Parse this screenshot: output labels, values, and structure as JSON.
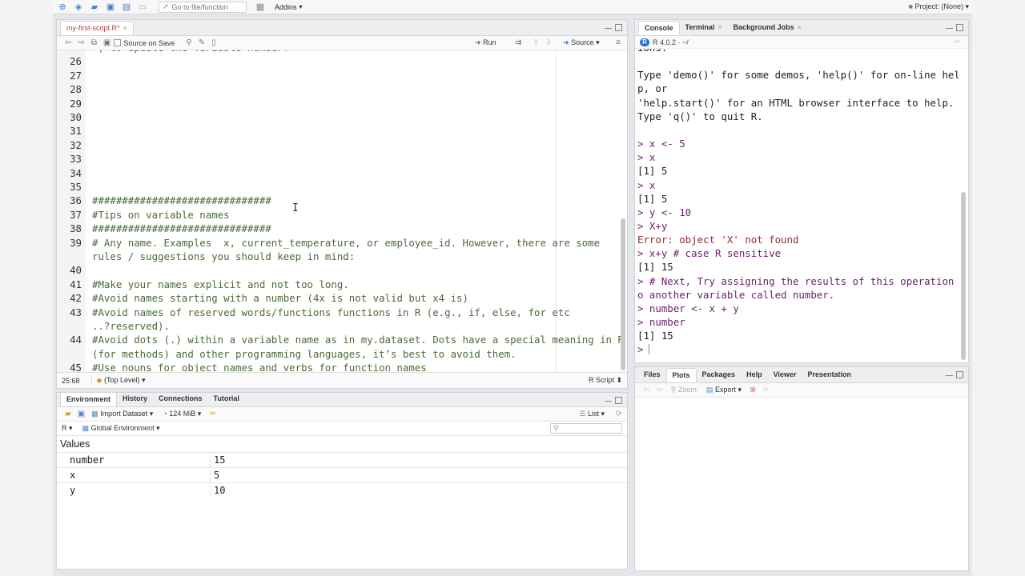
{
  "topbar": {
    "goto_placeholder": "Go to file/function",
    "addins_label": "Addins",
    "project_label": "Project: (None)"
  },
  "editor": {
    "tab_label": "my-first-script.R*",
    "source_on_save": "Source on Save",
    "run_label": "Run",
    "source_label": "Source",
    "cursor_pos": "25:68",
    "top_level": "(Top Level)",
    "file_type": "R Script",
    "lines": [
      {
        "num": "",
        "text": " , to update the variable number?",
        "comment": true
      },
      {
        "num": "26",
        "text": "",
        "comment": false
      },
      {
        "num": "27",
        "text": "",
        "comment": false
      },
      {
        "num": "28",
        "text": "",
        "comment": false
      },
      {
        "num": "29",
        "text": "",
        "comment": false
      },
      {
        "num": "30",
        "text": "",
        "comment": false
      },
      {
        "num": "31",
        "text": "",
        "comment": false
      },
      {
        "num": "32",
        "text": "",
        "comment": false
      },
      {
        "num": "33",
        "text": "",
        "comment": false
      },
      {
        "num": "34",
        "text": "",
        "comment": false
      },
      {
        "num": "35",
        "text": "",
        "comment": false
      },
      {
        "num": "36",
        "text": "##############################",
        "comment": true
      },
      {
        "num": "37",
        "text": "#Tips on variable names",
        "comment": true
      },
      {
        "num": "38",
        "text": "##############################",
        "comment": true
      },
      {
        "num": "39",
        "text": "# Any name. Examples  x, current_temperature, or employee_id. However, there are some",
        "comment": true
      },
      {
        "num": "",
        "text": "rules / suggestions you should keep in mind:",
        "comment": true
      },
      {
        "num": "40",
        "text": "",
        "comment": false
      },
      {
        "num": "41",
        "text": "#Make your names explicit and not too long.",
        "comment": true
      },
      {
        "num": "42",
        "text": "#Avoid names starting with a number (4x is not valid but x4 is)",
        "comment": true
      },
      {
        "num": "43",
        "text": "#Avoid names of reserved words/functions functions in R (e.g., if, else, for etc",
        "comment": true
      },
      {
        "num": "",
        "text": "..?reserved).",
        "comment": true
      },
      {
        "num": "44",
        "text": "#Avoid dots (.) within a variable name as in my.dataset. Dots have a special meaning in R",
        "comment": true
      },
      {
        "num": "",
        "text": "(for methods) and other programming languages, it’s best to avoid them.",
        "comment": true
      },
      {
        "num": "45",
        "text": "#Use nouns for object names and verbs for function names",
        "comment": true
      }
    ]
  },
  "environment": {
    "tabs": [
      "Environment",
      "History",
      "Connections",
      "Tutorial"
    ],
    "import_dataset": "Import Dataset",
    "memory": "124 MiB",
    "list_label": "List",
    "r_label": "R",
    "scope": "Global Environment",
    "values_heading": "Values",
    "rows": [
      {
        "name": "number",
        "value": "15"
      },
      {
        "name": "x",
        "value": "5"
      },
      {
        "name": "y",
        "value": "10"
      }
    ]
  },
  "console": {
    "tabs": [
      "Console",
      "Terminal",
      "Background Jobs"
    ],
    "r_version": "R 4.0.2 · ~/",
    "lines": [
      {
        "text": "ions.",
        "kind": "out"
      },
      {
        "text": "",
        "kind": "out"
      },
      {
        "text": "Type 'demo()' for some demos, 'help()' for on-line hel",
        "kind": "out"
      },
      {
        "text": "p, or",
        "kind": "out"
      },
      {
        "text": "'help.start()' for an HTML browser interface to help.",
        "kind": "out"
      },
      {
        "text": "Type 'q()' to quit R.",
        "kind": "out"
      },
      {
        "text": "",
        "kind": "out"
      },
      {
        "text": "> x <- 5",
        "kind": "in"
      },
      {
        "text": "> x",
        "kind": "in"
      },
      {
        "text": "[1] 5",
        "kind": "out"
      },
      {
        "text": "> x",
        "kind": "in"
      },
      {
        "text": "[1] 5",
        "kind": "out"
      },
      {
        "text": "> y <- 10",
        "kind": "in"
      },
      {
        "text": "> X+y",
        "kind": "in"
      },
      {
        "text": "Error: object 'X' not found",
        "kind": "err"
      },
      {
        "text": "> x+y # case R sensitive",
        "kind": "in"
      },
      {
        "text": "[1] 15",
        "kind": "out"
      },
      {
        "text": "> # Next, Try assigning the results of this operation t",
        "kind": "in"
      },
      {
        "text": "o another variable called number.",
        "kind": "in"
      },
      {
        "text": "> number <- x + y",
        "kind": "in"
      },
      {
        "text": "> number",
        "kind": "in"
      },
      {
        "text": "[1] 15",
        "kind": "out"
      },
      {
        "text": "> ",
        "kind": "in"
      }
    ]
  },
  "files": {
    "tabs": [
      "Files",
      "Plots",
      "Packages",
      "Help",
      "Viewer",
      "Presentation"
    ],
    "zoom_label": "Zoom",
    "export_label": "Export"
  }
}
